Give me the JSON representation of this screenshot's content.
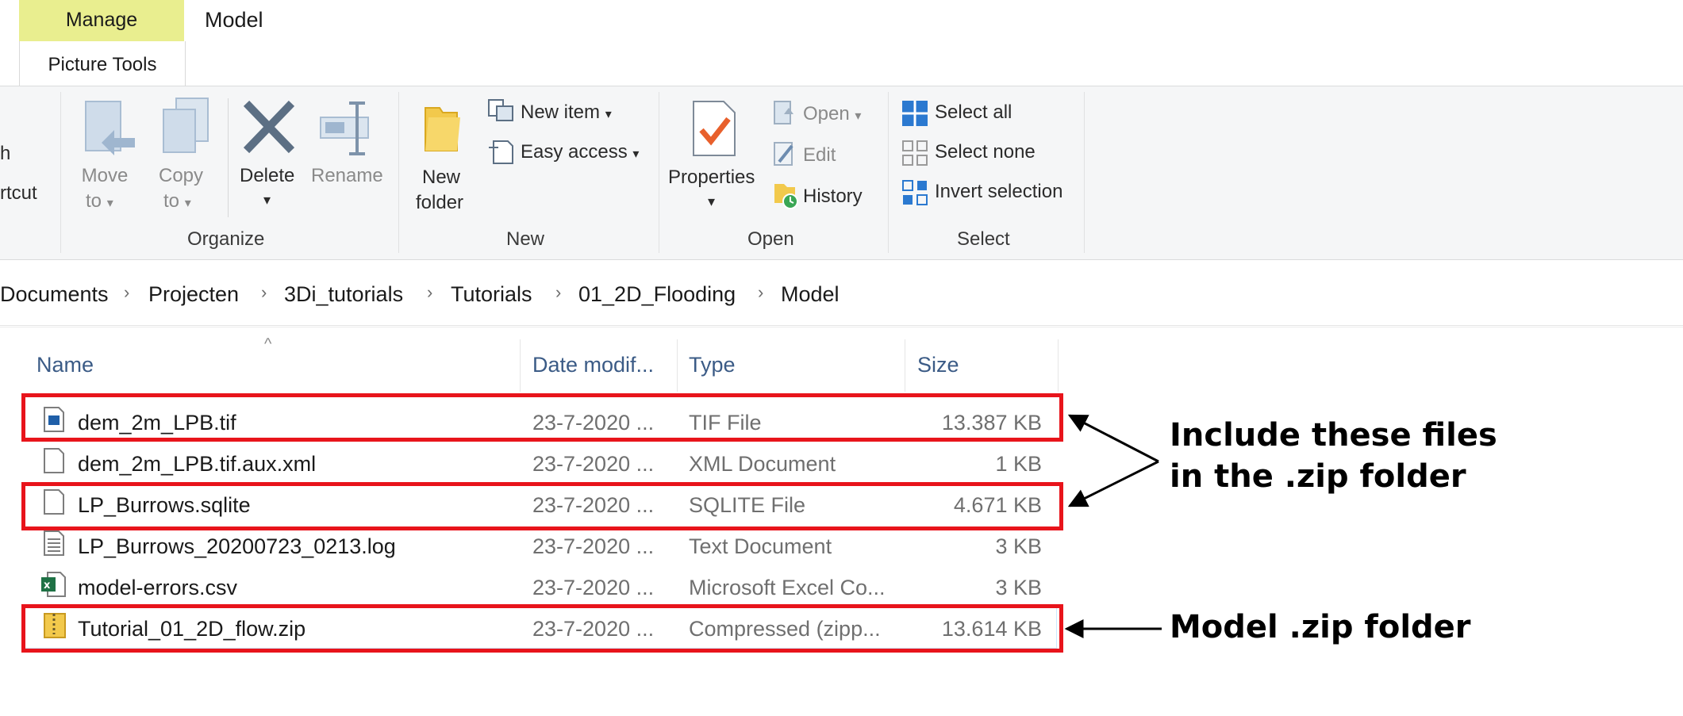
{
  "tabs": {
    "context_tab": "Manage",
    "current_tab": "Model",
    "context_sub": "Picture Tools"
  },
  "ribbon": {
    "clip_partial": [
      "h",
      "rtcut"
    ],
    "organize": {
      "move_to": [
        "Move",
        "to"
      ],
      "copy_to": [
        "Copy",
        "to"
      ],
      "delete": "Delete",
      "rename": "Rename",
      "label": "Organize"
    },
    "new": {
      "new_folder": [
        "New",
        "folder"
      ],
      "new_item": "New item",
      "easy_access": "Easy access",
      "label": "New"
    },
    "open": {
      "properties": "Properties",
      "open": "Open",
      "edit": "Edit",
      "history": "History",
      "label": "Open"
    },
    "select": {
      "select_all": "Select all",
      "select_none": "Select none",
      "invert_selection": "Invert selection",
      "label": "Select"
    }
  },
  "breadcrumb": [
    "Documents",
    "Projecten",
    "3Di_tutorials",
    "Tutorials",
    "01_2D_Flooding",
    "Model"
  ],
  "columns": {
    "name": "Name",
    "date": "Date modif...",
    "type": "Type",
    "size": "Size"
  },
  "files": [
    {
      "name": "dem_2m_LPB.tif",
      "date": "23-7-2020 ...",
      "type": "TIF File",
      "size": "13.387 KB",
      "icon": "image-file-icon"
    },
    {
      "name": "dem_2m_LPB.tif.aux.xml",
      "date": "23-7-2020 ...",
      "type": "XML Document",
      "size": "1 KB",
      "icon": "blank-file-icon"
    },
    {
      "name": "LP_Burrows.sqlite",
      "date": "23-7-2020 ...",
      "type": "SQLITE File",
      "size": "4.671 KB",
      "icon": "blank-file-icon"
    },
    {
      "name": "LP_Burrows_20200723_0213.log",
      "date": "23-7-2020 ...",
      "type": "Text Document",
      "size": "3 KB",
      "icon": "text-file-icon"
    },
    {
      "name": "model-errors.csv",
      "date": "23-7-2020 ...",
      "type": "Microsoft Excel Co...",
      "size": "3 KB",
      "icon": "excel-file-icon"
    },
    {
      "name": "Tutorial_01_2D_flow.zip",
      "date": "23-7-2020 ...",
      "type": "Compressed (zipp...",
      "size": "13.614 KB",
      "icon": "zip-folder-icon"
    }
  ],
  "annotations": {
    "include_line1": "Include these files",
    "include_line2": "in the .zip folder",
    "model_zip": "Model .zip folder",
    "highlight_color": "#e8141b"
  },
  "colors": {
    "context_tab": "#e9ee8f",
    "ribbon_bg": "#f5f6f7",
    "header_text": "#3b5b86",
    "accent_blue": "#2b79d0"
  }
}
